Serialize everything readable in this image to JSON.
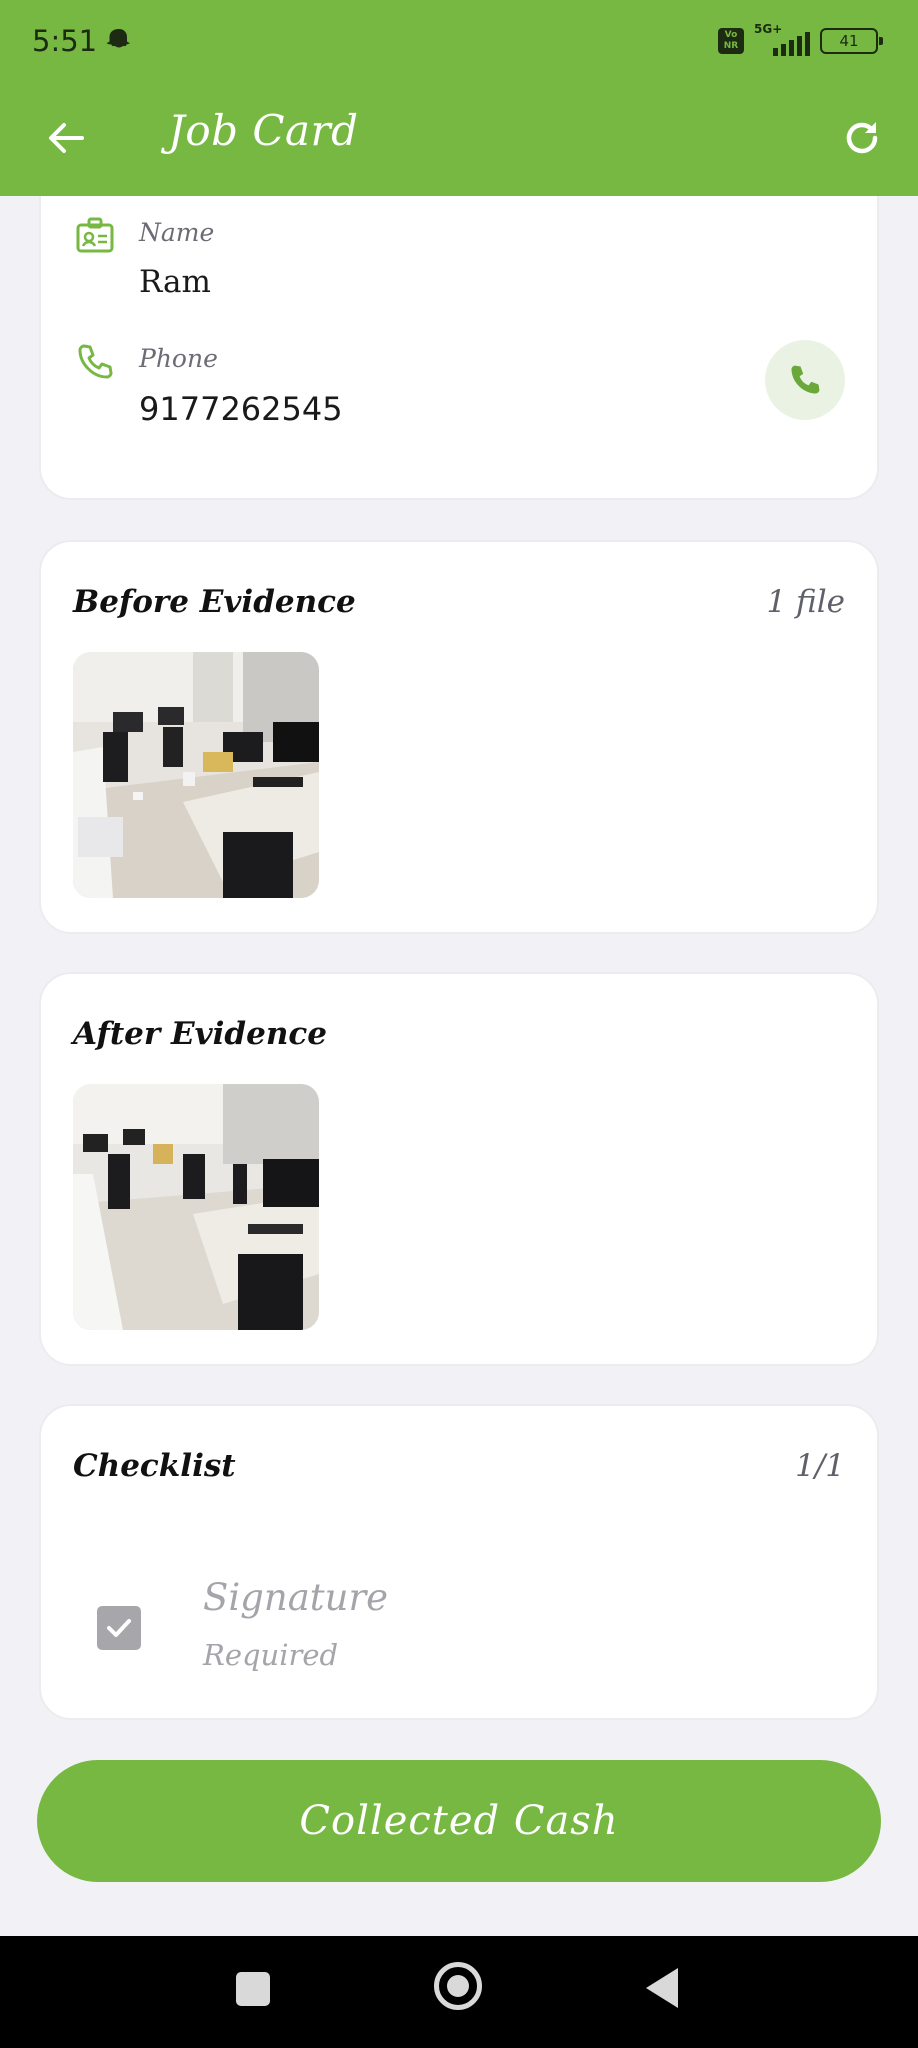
{
  "status_bar": {
    "time": "5:51",
    "network_type": "5G+",
    "volte_label": "Vo NR",
    "battery_level": "41",
    "notification_icon": "ghost-icon"
  },
  "app_bar": {
    "title": "Job Card",
    "back_icon": "arrow-left-icon",
    "refresh_icon": "refresh-icon"
  },
  "customer": {
    "name_label": "Name",
    "name_value": "Ram",
    "phone_label": "Phone",
    "phone_value": "9177262545",
    "call_icon": "phone-icon"
  },
  "before_evidence": {
    "title": "Before Evidence",
    "file_count": "1 file",
    "image": "office-photo-before"
  },
  "after_evidence": {
    "title": "After Evidence",
    "image": "office-photo-after"
  },
  "checklist": {
    "title": "Checklist",
    "progress": "1/1",
    "items": [
      {
        "title": "Signature",
        "subtitle": "Required",
        "checked": true
      }
    ]
  },
  "primary_action": {
    "label": "Collected Cash"
  },
  "colors": {
    "brand_green": "#77b843",
    "card_bg": "#ffffff",
    "page_bg": "#f2f2f6",
    "muted_text": "#a4a4aa"
  }
}
